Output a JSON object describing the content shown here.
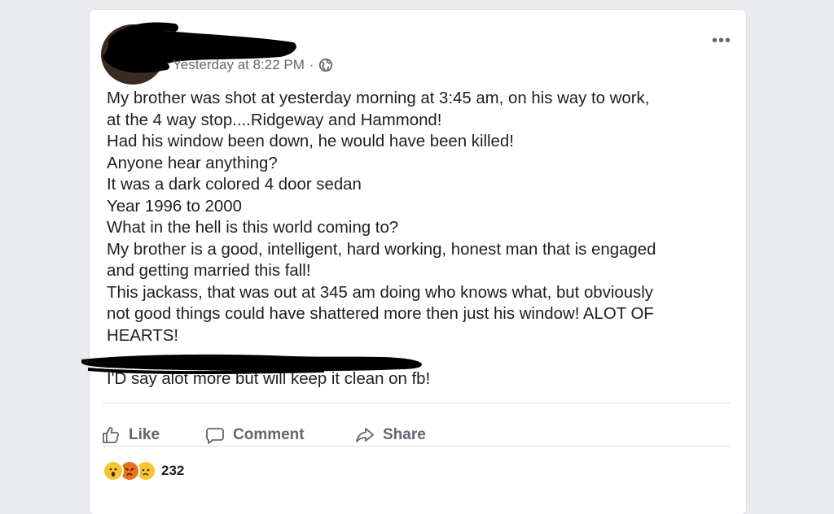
{
  "post": {
    "timestamp": "Yesterday at 8:22 PM",
    "separator": "·",
    "privacy_icon": "globe-icon",
    "more_label": "•••",
    "lines": [
      "My brother was shot at yesterday morning at 3:45 am,  on his way to work,",
      "at the 4 way stop....Ridgeway and Hammond!",
      "Had his window been down, he would have been killed!",
      "Anyone hear anything?",
      "It was a dark colored 4 door sedan",
      "Year 1996 to 2000",
      "What in the hell is this world coming to?",
      "My brother is a good, intelligent, hard working, honest man that is engaged",
      "and getting married this fall!",
      "This jackass, that was out at 345 am doing who knows what, but obviously",
      "not good things could have shattered more then just his window! ALOT OF",
      "HEARTS!",
      "",
      "I'D say alot more but will keep it clean on fb!"
    ]
  },
  "actions": {
    "like": "Like",
    "comment": "Comment",
    "share": "Share"
  },
  "reactions": {
    "icons": [
      "wow-emoji-icon",
      "angry-emoji-icon",
      "sad-emoji-icon"
    ],
    "count": "232"
  },
  "colors": {
    "background": "#e9ebee",
    "card": "#ffffff",
    "text": "#1c1e21",
    "muted": "#606770"
  }
}
